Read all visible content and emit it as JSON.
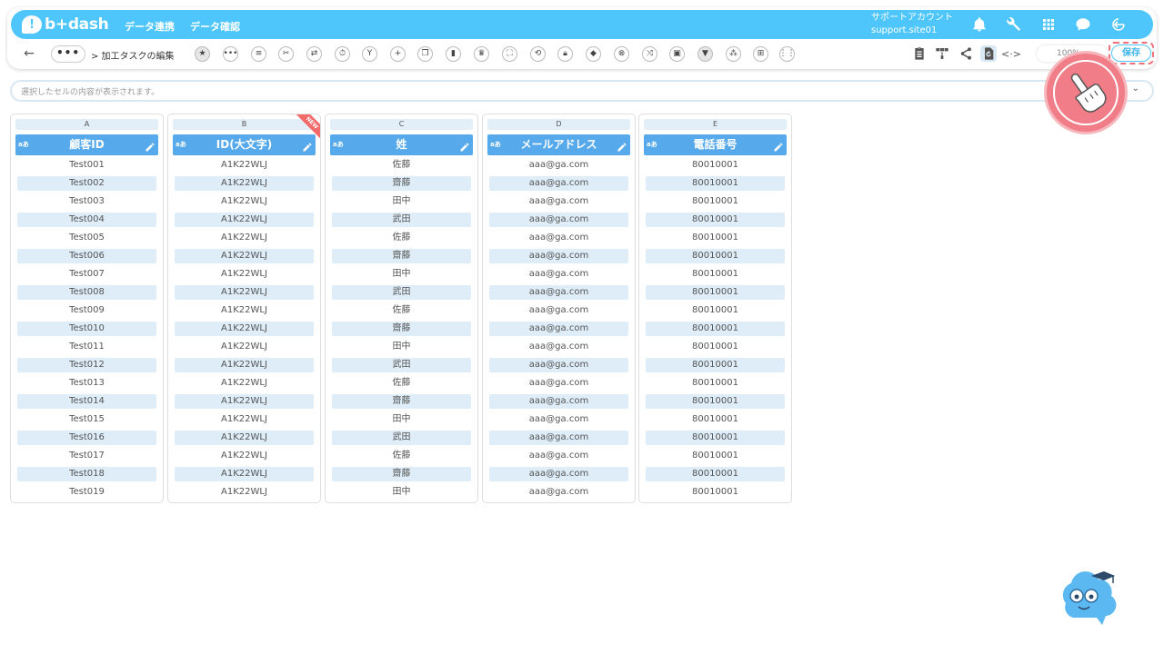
{
  "header": {
    "logo_text": "b+dash",
    "nav": [
      "データ連携",
      "データ確認"
    ],
    "account_name": "サポートアカウント",
    "account_id": "support.site01",
    "icons": [
      "bell-icon",
      "wrench-icon",
      "grid-icon",
      "chat-icon",
      "logout-icon"
    ]
  },
  "toolbar": {
    "more_label": "•••",
    "breadcrumb": "> 加工タスクの編集",
    "zoom": "100%",
    "save_label": "保存"
  },
  "cellbar": {
    "placeholder": "選択したセルの内容が表示されます。"
  },
  "columns": [
    {
      "letter": "A",
      "type": "aあ",
      "header": "顧客ID",
      "new": false,
      "values": [
        "Test001",
        "Test002",
        "Test003",
        "Test004",
        "Test005",
        "Test006",
        "Test007",
        "Test008",
        "Test009",
        "Test010",
        "Test011",
        "Test012",
        "Test013",
        "Test014",
        "Test015",
        "Test016",
        "Test017",
        "Test018",
        "Test019"
      ]
    },
    {
      "letter": "B",
      "type": "aあ",
      "header": "ID(大文字)",
      "new": true,
      "badge": "NEW",
      "values": [
        "A1K22WLJ",
        "A1K22WLJ",
        "A1K22WLJ",
        "A1K22WLJ",
        "A1K22WLJ",
        "A1K22WLJ",
        "A1K22WLJ",
        "A1K22WLJ",
        "A1K22WLJ",
        "A1K22WLJ",
        "A1K22WLJ",
        "A1K22WLJ",
        "A1K22WLJ",
        "A1K22WLJ",
        "A1K22WLJ",
        "A1K22WLJ",
        "A1K22WLJ",
        "A1K22WLJ",
        "A1K22WLJ"
      ]
    },
    {
      "letter": "C",
      "type": "aあ",
      "header": "姓",
      "new": false,
      "values": [
        "佐藤",
        "齋藤",
        "田中",
        "武田",
        "佐藤",
        "齋藤",
        "田中",
        "武田",
        "佐藤",
        "齋藤",
        "田中",
        "武田",
        "佐藤",
        "齋藤",
        "田中",
        "武田",
        "佐藤",
        "齋藤",
        "田中"
      ]
    },
    {
      "letter": "D",
      "type": "aあ",
      "header": "メールアドレス",
      "new": false,
      "values": [
        "aaa@ga.com",
        "aaa@ga.com",
        "aaa@ga.com",
        "aaa@ga.com",
        "aaa@ga.com",
        "aaa@ga.com",
        "aaa@ga.com",
        "aaa@ga.com",
        "aaa@ga.com",
        "aaa@ga.com",
        "aaa@ga.com",
        "aaa@ga.com",
        "aaa@ga.com",
        "aaa@ga.com",
        "aaa@ga.com",
        "aaa@ga.com",
        "aaa@ga.com",
        "aaa@ga.com",
        "aaa@ga.com"
      ]
    },
    {
      "letter": "E",
      "type": "aあ",
      "header": "電話番号",
      "new": false,
      "values": [
        "80010001",
        "80010001",
        "80010001",
        "80010001",
        "80010001",
        "80010001",
        "80010001",
        "80010001",
        "80010001",
        "80010001",
        "80010001",
        "80010001",
        "80010001",
        "80010001",
        "80010001",
        "80010001",
        "80010001",
        "80010001",
        "80010001"
      ]
    }
  ],
  "colors": {
    "header_bg": "#4ec6fb",
    "column_header_bg": "#56a9ea",
    "alt_row_bg": "#deedf8",
    "highlight": "#f07d87"
  }
}
